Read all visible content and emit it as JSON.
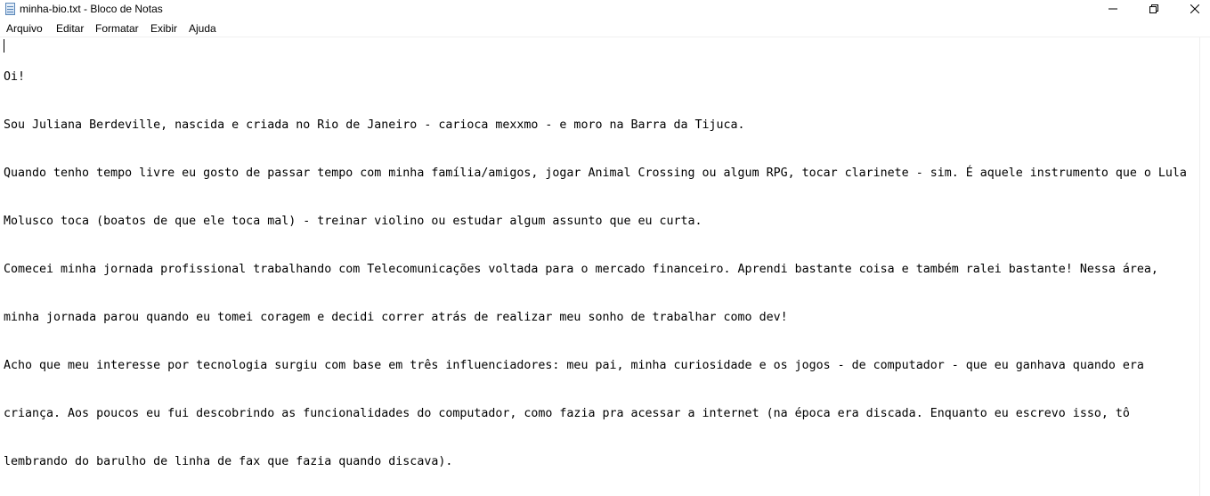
{
  "window": {
    "title": "minha-bio.txt - Bloco de Notas",
    "icon": "notepad-icon",
    "controls": [
      "minimize-icon",
      "restore-icon",
      "close-icon"
    ]
  },
  "menu": {
    "items": [
      "Arquivo",
      "Editar",
      "Formatar",
      "Exibir",
      "Ajuda"
    ]
  },
  "document": {
    "lines": [
      "Oi!",
      "Sou Juliana Berdeville, nascida e criada no Rio de Janeiro - carioca mexxmo - e moro na Barra da Tijuca.",
      "Quando tenho tempo livre eu gosto de passar tempo com minha família/amigos, jogar Animal Crossing ou algum RPG, tocar clarinete - sim. É aquele instrumento que o Lula",
      "Molusco toca (boatos de que ele toca mal) - treinar violino ou estudar algum assunto que eu curta.",
      "Comecei minha jornada profissional trabalhando com Telecomunicações voltada para o mercado financeiro. Aprendi bastante coisa e também ralei bastante! Nessa área,",
      "minha jornada parou quando eu tomei coragem e decidi correr atrás de realizar meu sonho de trabalhar como dev!",
      "Acho que meu interesse por tecnologia surgiu com base em três influenciadores: meu pai, minha curiosidade e os jogos - de computador - que eu ganhava quando era",
      "criança. Aos poucos eu fui descobrindo as funcionalidades do computador, como fazia pra acessar a internet (na época era discada. Enquanto eu escrevo isso, tô",
      "lembrando do barulho de linha de fax que fazia quando discava)."
    ]
  }
}
